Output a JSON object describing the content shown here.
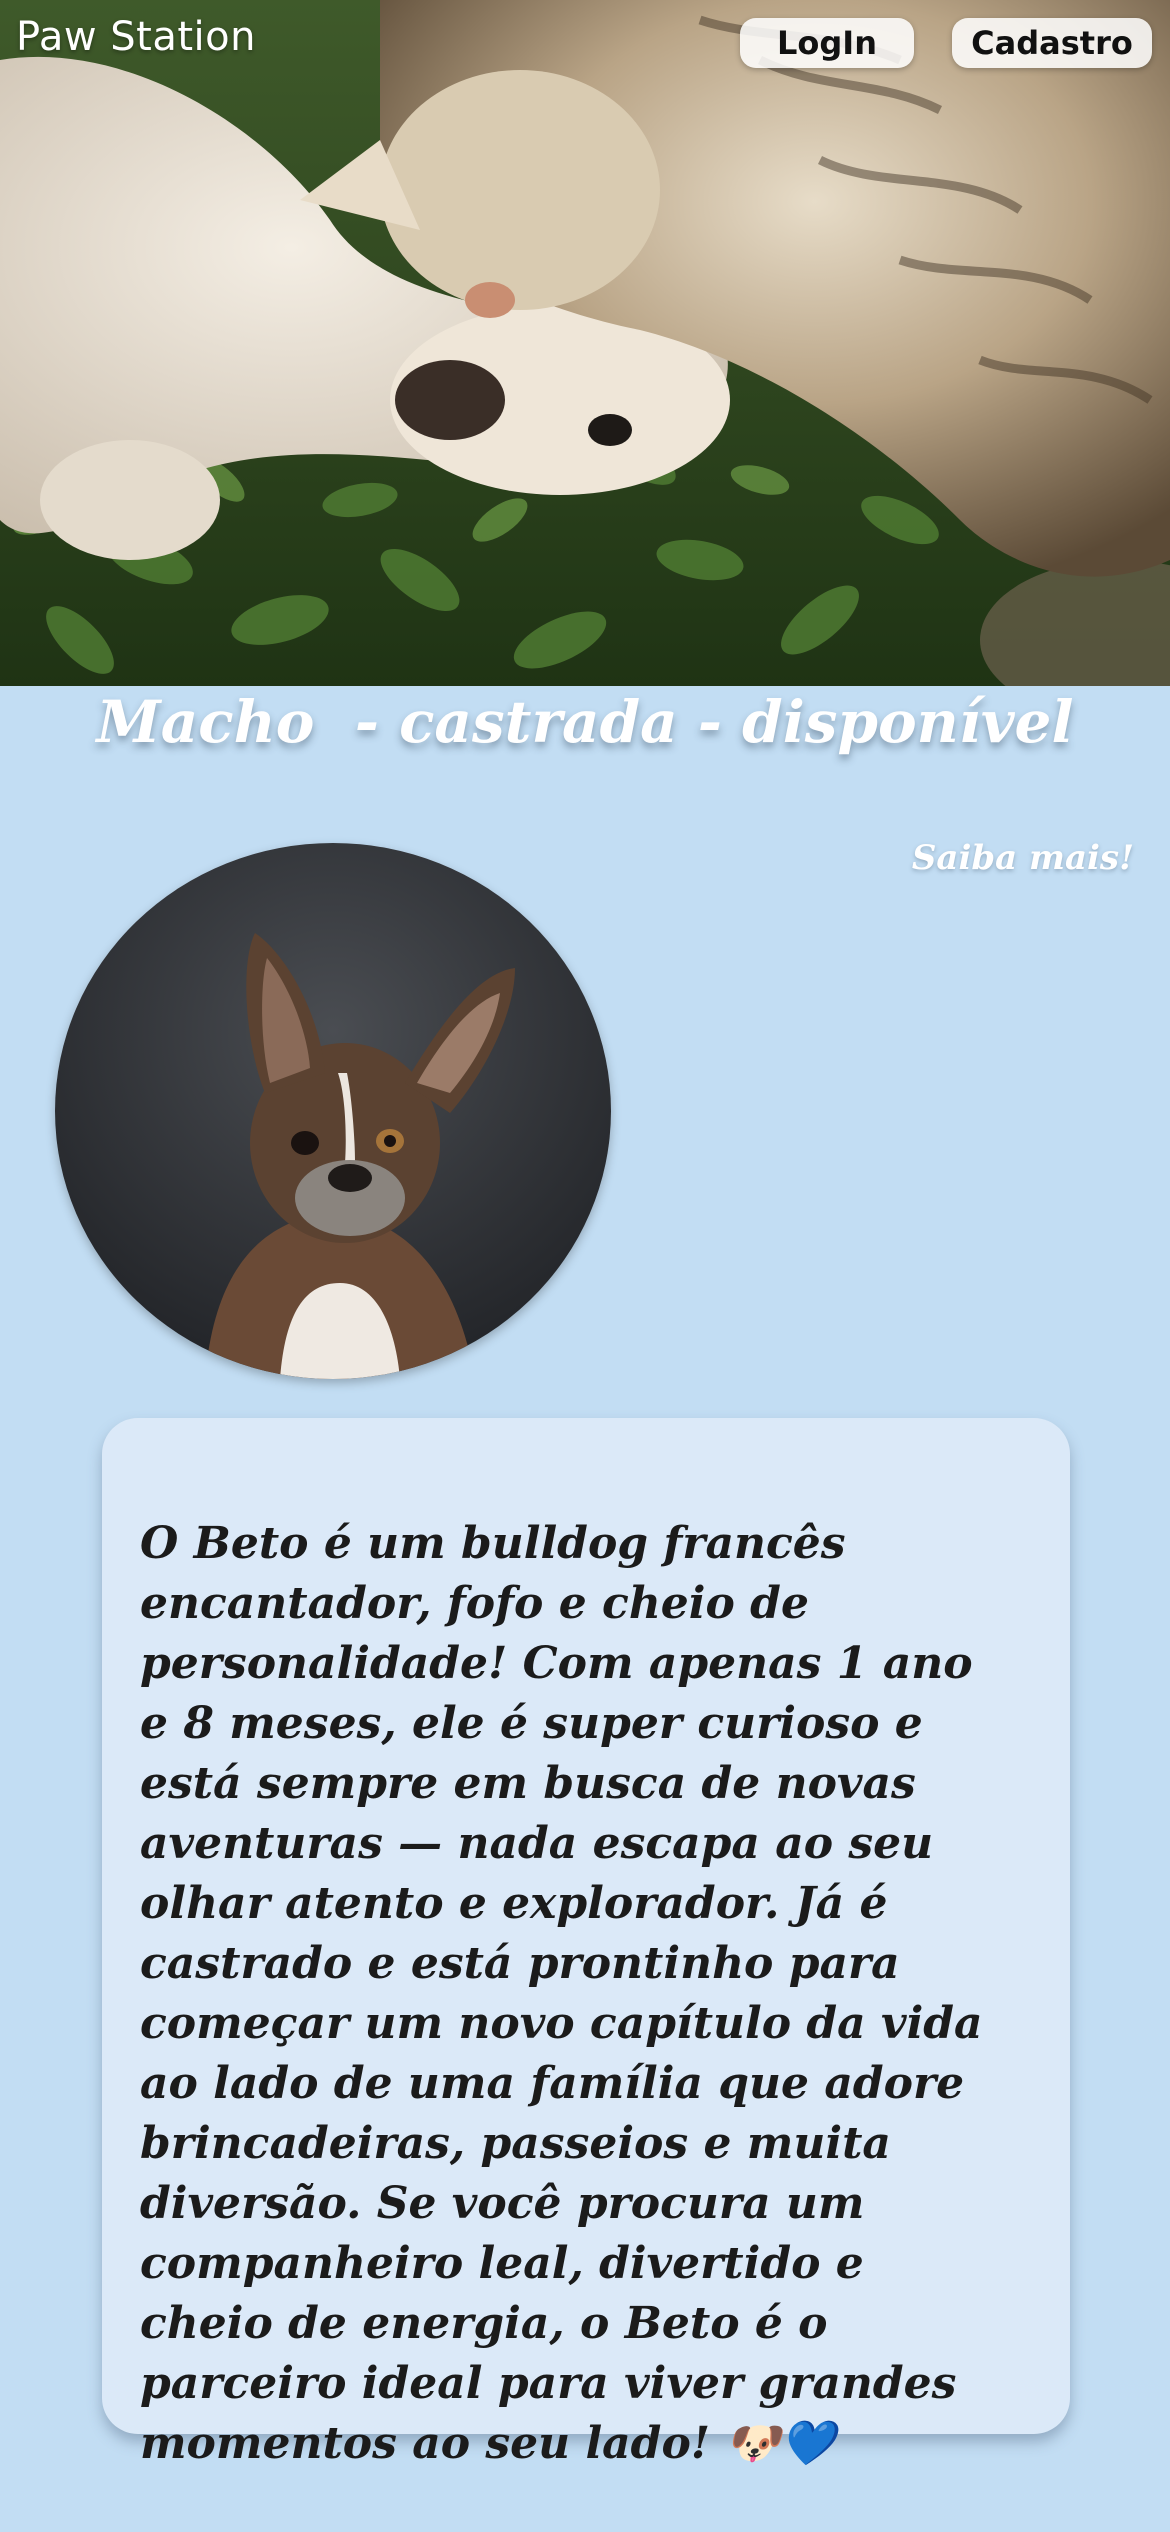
{
  "header": {
    "brand": "Paw Station",
    "login_label": "LogIn",
    "cadastro_label": "Cadastro"
  },
  "hero_image": {
    "subject": "cat-and-dog-on-grass-photo"
  },
  "pet": {
    "status_line": "Macho  - castrada - disponível",
    "more_link": "Saiba mais!",
    "photo": "french-bulldog-portrait-photo",
    "description": "O Beto é um bulldog francês encantador, fofo e cheio de personalidade! Com apenas 1 ano e 8 meses, ele é super curioso e está sempre em busca de novas aventuras — nada escapa ao seu olhar atento e explorador. Já é castrado e está prontinho para começar um novo capítulo da vida ao lado de uma família que adore brincadeiras, passeios e muita diversão. Se você procura um companheiro leal, divertido e cheio de energia, o Beto é o parceiro ideal para viver grandes momentos ao seu lado! 🐶💙"
  },
  "colors": {
    "page_background": "#c2ddf3",
    "card_background": "#dbe9f8",
    "text": "#1b1b1b",
    "heading_text": "#ffffff"
  }
}
